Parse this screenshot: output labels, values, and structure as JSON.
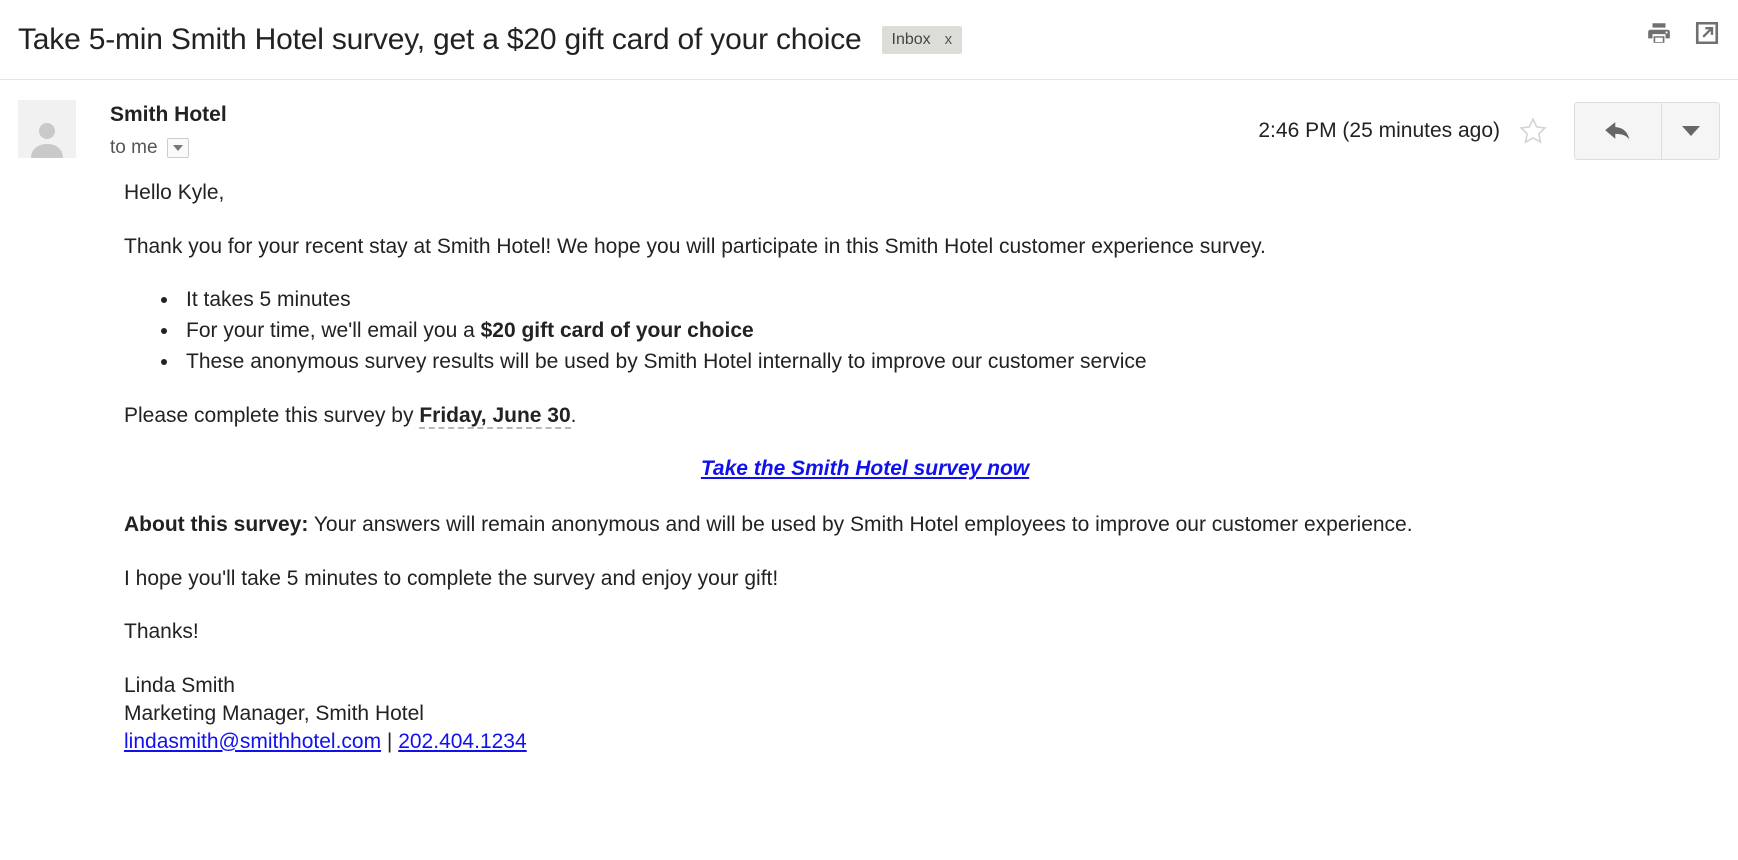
{
  "header": {
    "subject": "Take 5-min Smith Hotel survey, get a $20 gift card of your choice",
    "label": "Inbox",
    "label_remove": "x",
    "print_icon": "print-icon",
    "popout_icon": "open-in-new-window-icon"
  },
  "message": {
    "sender": "Smith Hotel",
    "recipient": "to me",
    "recipient_caret": "details-dropdown-icon",
    "timestamp": "2:46 PM (25 minutes ago)",
    "star_icon": "star-outline-icon",
    "reply_icon": "reply-arrow-icon",
    "more_icon": "more-options-caret-icon",
    "avatar_icon": "default-avatar-icon"
  },
  "body": {
    "greeting": "Hello Kyle,",
    "intro": "Thank you for your recent stay at Smith Hotel! We hope you will participate in this Smith Hotel customer experience survey.",
    "bullets": [
      {
        "text": "It takes 5 minutes",
        "bold": ""
      },
      {
        "text": "For your time, we'll email you a ",
        "bold": "$20 gift card of your choice"
      },
      {
        "text": "These anonymous survey results will be used by Smith Hotel internally to improve our customer service",
        "bold": ""
      }
    ],
    "deadline_prefix": "Please complete this survey by ",
    "deadline_date": "Friday, June 30",
    "deadline_suffix": ".",
    "survey_link": "Take the Smith Hotel survey now",
    "about_label": "About this survey:",
    "about_text": " Your answers will remain anonymous and will be used by Smith Hotel employees to improve our customer experience.",
    "hope_line": "I hope you'll take 5 minutes to complete the survey and enjoy your gift!",
    "thanks": "Thanks!",
    "signature_name": "Linda Smith",
    "signature_title": "Marketing Manager, Smith Hotel",
    "signature_email": "lindasmith@smithhotel.com",
    "signature_separator": " | ",
    "signature_phone": "202.404.1234"
  },
  "colors": {
    "link": "#1111ee",
    "chip_bg": "#ddddd8",
    "text": "#222222"
  }
}
